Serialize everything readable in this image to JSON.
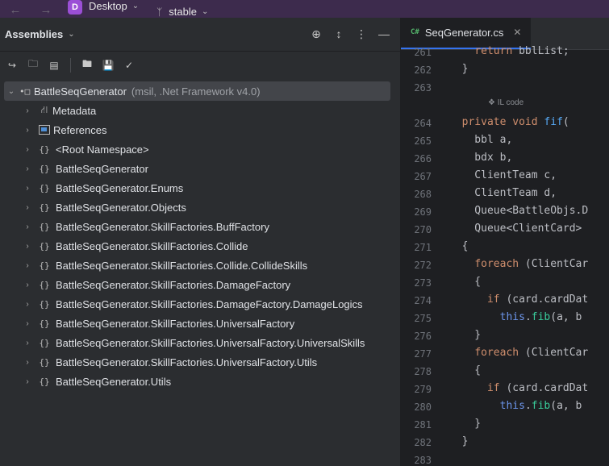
{
  "titlebar": {
    "back_icon": "arrow-left-icon",
    "forward_icon": "arrow-right-icon",
    "project_badge": "D",
    "project_name": "Desktop",
    "branch_name": "stable"
  },
  "panel": {
    "title": "Assemblies",
    "header_icons": [
      "crosshair-icon",
      "collapse-icon",
      "more-icon",
      "minimize-icon"
    ],
    "toolbar_icons": [
      "open-assembly-icon",
      "add-folder-icon",
      "assembly-list-icon",
      "folder-icon",
      "save-icon",
      "filter-icon"
    ]
  },
  "tree": {
    "root": {
      "label": "BattleSeqGenerator",
      "meta": "(msil, .Net Framework v4.0)"
    },
    "items": [
      {
        "icon": "tag",
        "label": "Metadata"
      },
      {
        "icon": "ref",
        "label": "References"
      },
      {
        "icon": "ns",
        "label": "<Root Namespace>"
      },
      {
        "icon": "ns",
        "label": "BattleSeqGenerator"
      },
      {
        "icon": "ns",
        "label": "BattleSeqGenerator.Enums"
      },
      {
        "icon": "ns",
        "label": "BattleSeqGenerator.Objects"
      },
      {
        "icon": "ns",
        "label": "BattleSeqGenerator.SkillFactories.BuffFactory"
      },
      {
        "icon": "ns",
        "label": "BattleSeqGenerator.SkillFactories.Collide"
      },
      {
        "icon": "ns",
        "label": "BattleSeqGenerator.SkillFactories.Collide.CollideSkills"
      },
      {
        "icon": "ns",
        "label": "BattleSeqGenerator.SkillFactories.DamageFactory"
      },
      {
        "icon": "ns",
        "label": "BattleSeqGenerator.SkillFactories.DamageFactory.DamageLogics"
      },
      {
        "icon": "ns",
        "label": "BattleSeqGenerator.SkillFactories.UniversalFactory"
      },
      {
        "icon": "ns",
        "label": "BattleSeqGenerator.SkillFactories.UniversalFactory.UniversalSkills"
      },
      {
        "icon": "ns",
        "label": "BattleSeqGenerator.SkillFactories.UniversalFactory.Utils"
      },
      {
        "icon": "ns",
        "label": "BattleSeqGenerator.Utils"
      }
    ]
  },
  "editor": {
    "tab": {
      "lang_badge": "C#",
      "name": "SeqGenerator.cs"
    },
    "il_hint": "IL code",
    "lines": [
      {
        "n": "261",
        "text": "    return bblList;"
      },
      {
        "n": "262",
        "text": "  }"
      },
      {
        "n": "263",
        "text": ""
      },
      {
        "n": "264",
        "text": "  private void fif("
      },
      {
        "n": "265",
        "text": "    bbl a,"
      },
      {
        "n": "266",
        "text": "    bdx b,"
      },
      {
        "n": "267",
        "text": "    ClientTeam c,"
      },
      {
        "n": "268",
        "text": "    ClientTeam d,"
      },
      {
        "n": "269",
        "text": "    Queue<BattleObjs.D"
      },
      {
        "n": "270",
        "text": "    Queue<ClientCard> "
      },
      {
        "n": "271",
        "text": "  {"
      },
      {
        "n": "272",
        "text": "    foreach (ClientCar"
      },
      {
        "n": "273",
        "text": "    {"
      },
      {
        "n": "274",
        "text": "      if (card.cardDat"
      },
      {
        "n": "275",
        "text": "        this.fib(a, b"
      },
      {
        "n": "276",
        "text": "    }"
      },
      {
        "n": "277",
        "text": "    foreach (ClientCar"
      },
      {
        "n": "278",
        "text": "    {"
      },
      {
        "n": "279",
        "text": "      if (card.cardDat"
      },
      {
        "n": "280",
        "text": "        this.fib(a, b"
      },
      {
        "n": "281",
        "text": "    }"
      },
      {
        "n": "282",
        "text": "  }"
      },
      {
        "n": "283",
        "text": ""
      }
    ]
  }
}
